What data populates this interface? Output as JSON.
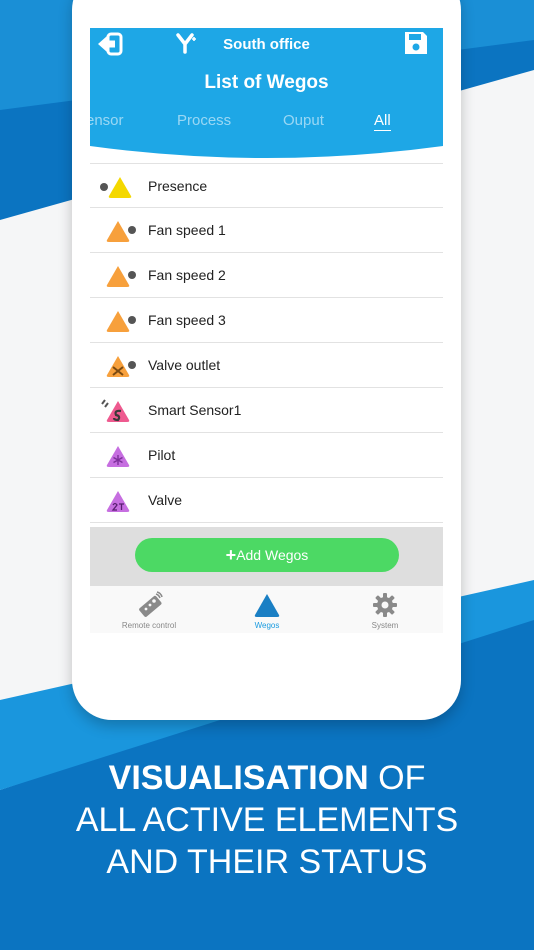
{
  "header": {
    "office_name": "South office",
    "list_title": "List of Wegos",
    "tabs": [
      "ensor",
      "Process",
      "Ouput",
      "All"
    ]
  },
  "wegos": [
    {
      "label": "Presence",
      "icon": "yellow-triangle-sensor-icon",
      "color": "#f4d800"
    },
    {
      "label": "Fan speed 1",
      "icon": "orange-triangle-output-icon",
      "color": "#f7a03c"
    },
    {
      "label": "Fan speed 2",
      "icon": "orange-triangle-output-icon",
      "color": "#f7a03c"
    },
    {
      "label": "Fan speed 3",
      "icon": "orange-triangle-output-icon",
      "color": "#f7a03c"
    },
    {
      "label": "Valve outlet",
      "icon": "orange-triangle-valve-icon",
      "color": "#f7a03c"
    },
    {
      "label": "Smart Sensor1",
      "icon": "pink-triangle-smart-sensor-icon",
      "color": "#ee5a8f"
    },
    {
      "label": "Pilot",
      "icon": "purple-triangle-pilot-icon",
      "color": "#c66ee0"
    },
    {
      "label": "Valve",
      "icon": "purple-triangle-2t-icon",
      "color": "#c66ee0"
    }
  ],
  "add_button": {
    "label": "Add Wegos",
    "color": "#4cd964"
  },
  "nav": {
    "remote": "Remote control",
    "wegos": "Wegos",
    "system": "System"
  },
  "promo": {
    "bold": "VISUALISATION",
    "line1_rest": " OF",
    "line2": "ALL ACTIVE ELEMENTS",
    "line3": "AND THEIR STATUS"
  },
  "colors": {
    "accent": "#1ea7e6",
    "background_blue": "#0a73bf"
  }
}
